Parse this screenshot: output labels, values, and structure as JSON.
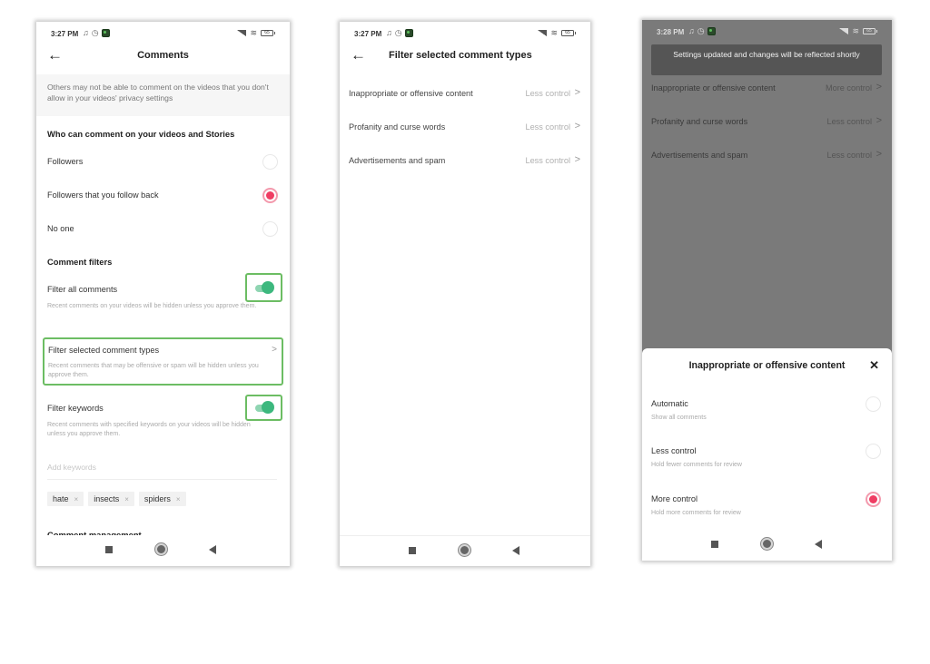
{
  "colors": {
    "accent_radio": "#ef3d63",
    "toggle_on": "#3db87e",
    "highlight_border": "#6cbd63",
    "overlay": "#7a7a7a",
    "toast_bg": "#555555"
  },
  "screens": [
    {
      "status": {
        "time": "3:27 PM",
        "battery": "65"
      },
      "header": {
        "title": "Comments",
        "back_icon": "arrow-left-icon"
      },
      "info_banner": "Others may not be able to comment on the videos that you don't allow in your videos' privacy settings",
      "who_can_comment": {
        "title": "Who can comment on your videos and Stories",
        "options": [
          {
            "label": "Followers",
            "selected": false
          },
          {
            "label": "Followers that you follow back",
            "selected": true
          },
          {
            "label": "No one",
            "selected": false
          }
        ]
      },
      "comment_filters": {
        "title": "Comment filters",
        "filter_all": {
          "label": "Filter all comments",
          "description": "Recent comments on your videos will be hidden unless you approve them.",
          "enabled": true
        },
        "filter_selected": {
          "label": "Filter selected comment types",
          "description": "Recent comments that may be offensive or spam will be hidden unless you approve them.",
          "chevron": ">"
        },
        "filter_keywords": {
          "label": "Filter keywords",
          "description": "Recent comments with specified keywords on your videos will be hidden unless you approve them.",
          "enabled": true,
          "input_placeholder": "Add keywords",
          "keywords": [
            "hate",
            "insects",
            "spiders"
          ],
          "remove_glyph": "×"
        }
      },
      "next_section_title": "Comment management"
    },
    {
      "status": {
        "time": "3:27 PM",
        "battery": "65"
      },
      "header": {
        "title": "Filter selected comment types",
        "back_icon": "arrow-left-icon"
      },
      "types": [
        {
          "label": "Inappropriate or offensive content",
          "value": "Less control"
        },
        {
          "label": "Profanity and curse words",
          "value": "Less control"
        },
        {
          "label": "Advertisements and spam",
          "value": "Less control"
        }
      ],
      "chevron": ">"
    },
    {
      "status": {
        "time": "3:28 PM",
        "battery": "65"
      },
      "toast": "Settings updated and changes will be reflected shortly",
      "types": [
        {
          "label": "Inappropriate or offensive content",
          "value": "More control"
        },
        {
          "label": "Profanity and curse words",
          "value": "Less control"
        },
        {
          "label": "Advertisements and spam",
          "value": "Less control"
        }
      ],
      "chevron": ">",
      "sheet": {
        "title": "Inappropriate or offensive content",
        "close_glyph": "✕",
        "options": [
          {
            "label": "Automatic",
            "description": "Show all comments",
            "selected": false
          },
          {
            "label": "Less control",
            "description": "Hold fewer comments for review",
            "selected": false
          },
          {
            "label": "More control",
            "description": "Hold more comments for review",
            "selected": true
          }
        ]
      }
    }
  ],
  "icons": {
    "notification": "♫",
    "alarm": "◷",
    "wifi": "≋",
    "back": "←"
  }
}
